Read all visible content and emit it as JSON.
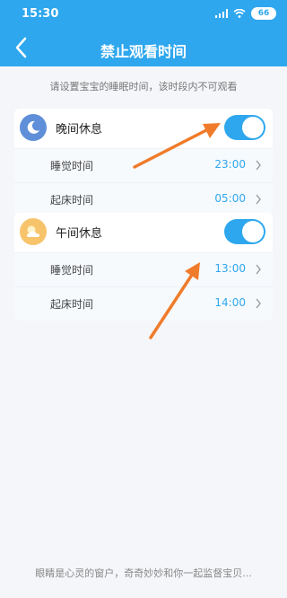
{
  "status_bar": {
    "time": "15:30",
    "battery": "66"
  },
  "header": {
    "title": "禁止观看时间"
  },
  "hint": "请设置宝宝的睡眠时间，该时段内不可观看",
  "sections": [
    {
      "title": "晚间休息",
      "icon": "moon-icon",
      "enabled": true,
      "rows": [
        {
          "label": "睡觉时间",
          "value": "23:00"
        },
        {
          "label": "起床时间",
          "value": "05:00"
        }
      ]
    },
    {
      "title": "午间休息",
      "icon": "sun-cloud-icon",
      "enabled": true,
      "rows": [
        {
          "label": "睡觉时间",
          "value": "13:00"
        },
        {
          "label": "起床时间",
          "value": "14:00"
        }
      ]
    }
  ],
  "footer": "眼睛是心灵的窗户，奇奇妙妙和你一起监督宝贝...",
  "colors": {
    "accent": "#2ea7ee",
    "annotation_arrow": "#f07b2a"
  }
}
